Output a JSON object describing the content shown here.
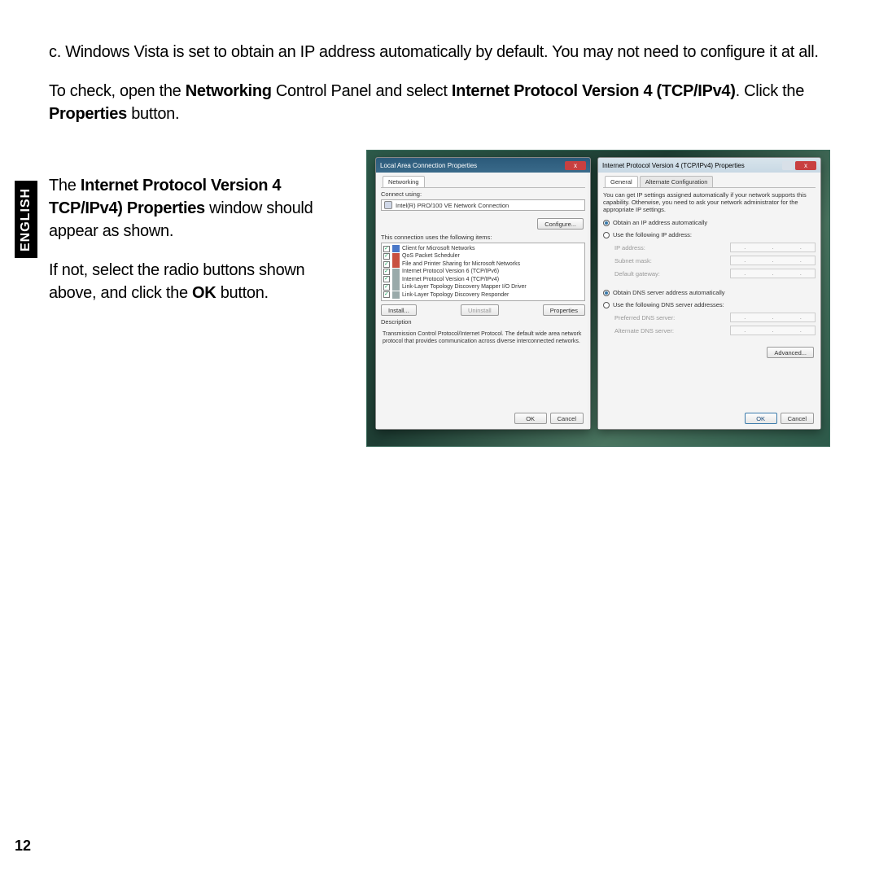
{
  "sideTab": "ENGLISH",
  "pageNumber": "12",
  "para1": "c. Windows Vista is set to obtain an IP address automatically by default. You may not need to configure it at all.",
  "para2_pre": "To check, open the ",
  "para2_b1": "Networking",
  "para2_mid": " Control Panel and select ",
  "para2_b2": "Internet Protocol Version 4 (TCP/IPv4)",
  "para2_post1": ". Click the ",
  "para2_b3": "Properties",
  "para2_post2": " button.",
  "leftA_pre": "The ",
  "leftA_b": "Internet Protocol Version 4 TCP/IPv4) Properties",
  "leftA_post": " window should appear as shown.",
  "leftB_pre": "If not, select the radio buttons shown above, and click the ",
  "leftB_b": "OK",
  "leftB_post": " button.",
  "winL": {
    "title": "Local Area Connection Properties",
    "tab": "Networking",
    "connectUsing": "Connect using:",
    "adapter": "Intel(R) PRO/100 VE Network Connection",
    "configure": "Configure...",
    "itemsHeader": "This connection uses the following items:",
    "items": [
      "Client for Microsoft Networks",
      "QoS Packet Scheduler",
      "File and Printer Sharing for Microsoft Networks",
      "Internet Protocol Version 6 (TCP/IPv6)",
      "Internet Protocol Version 4 (TCP/IPv4)",
      "Link-Layer Topology Discovery Mapper I/O Driver",
      "Link-Layer Topology Discovery Responder"
    ],
    "install": "Install...",
    "uninstall": "Uninstall",
    "properties": "Properties",
    "descLabel": "Description",
    "desc": "Transmission Control Protocol/Internet Protocol. The default wide area network protocol that provides communication across diverse interconnected networks.",
    "ok": "OK",
    "cancel": "Cancel"
  },
  "winR": {
    "title": "Internet Protocol Version 4 (TCP/IPv4) Properties",
    "tab1": "General",
    "tab2": "Alternate Configuration",
    "instr": "You can get IP settings assigned automatically if your network supports this capability. Otherwise, you need to ask your network administrator for the appropriate IP settings.",
    "radioAuto": "Obtain an IP address automatically",
    "radioManual": "Use the following IP address:",
    "ip": "IP address:",
    "mask": "Subnet mask:",
    "gw": "Default gateway:",
    "dnsAuto": "Obtain DNS server address automatically",
    "dnsManual": "Use the following DNS server addresses:",
    "dns1": "Preferred DNS server:",
    "dns2": "Alternate DNS server:",
    "advanced": "Advanced...",
    "ok": "OK",
    "cancel": "Cancel"
  }
}
